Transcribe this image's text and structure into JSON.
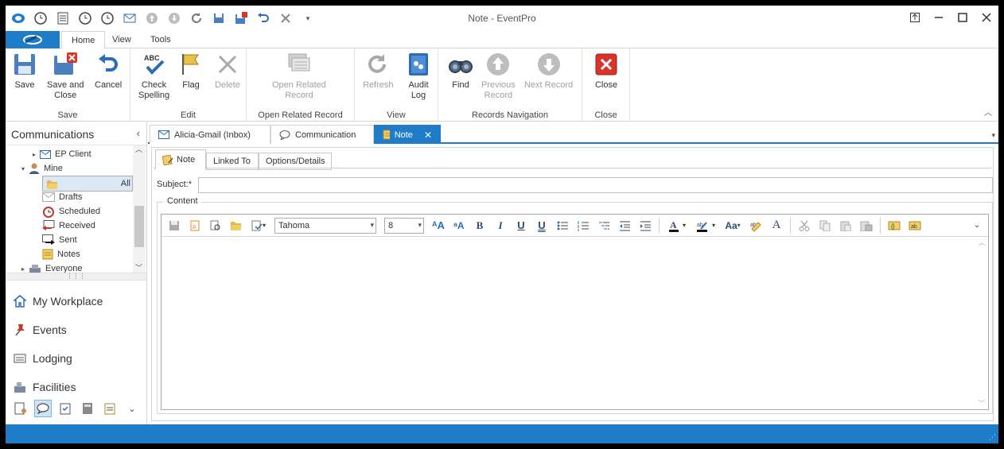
{
  "window": {
    "title": "Note - EventPro"
  },
  "quick_access_icons": [
    "eventpro-logo-icon",
    "clock-icon",
    "document-icon",
    "clock-icon",
    "clock-icon",
    "mail-icon",
    "up-arrow-icon",
    "down-arrow-icon",
    "refresh-icon",
    "save-icon",
    "save-close-icon",
    "undo-icon",
    "close-icon",
    "customize-icon"
  ],
  "ribbon": {
    "tabs": [
      "Home",
      "View",
      "Tools"
    ],
    "active_tab": "Home",
    "groups": {
      "save": {
        "caption": "Save",
        "save": "Save",
        "save_close_1": "Save and",
        "save_close_2": "Close",
        "cancel": "Cancel"
      },
      "edit": {
        "caption": "Edit",
        "check_1": "Check",
        "check_2": "Spelling",
        "check_abc": "ABC",
        "flag": "Flag",
        "delete": "Delete"
      },
      "open_related": {
        "caption": "Open Related Record",
        "btn_1": "Open Related",
        "btn_2": "Record"
      },
      "view": {
        "caption": "View",
        "refresh": "Refresh",
        "audit_1": "Audit",
        "audit_2": "Log"
      },
      "records_nav": {
        "caption": "Records Navigation",
        "find": "Find",
        "prev_1": "Previous",
        "prev_2": "Record",
        "next": "Next Record"
      },
      "close": {
        "caption": "Close",
        "close": "Close"
      }
    }
  },
  "nav": {
    "title": "Communications",
    "tree": [
      {
        "label": "EP Client",
        "icon": "mail-icon"
      },
      {
        "label": "Mine",
        "icon": "user-icon"
      },
      {
        "label": "All",
        "icon": "folder-open-icon",
        "selected": true
      },
      {
        "label": "Drafts",
        "icon": "mail-draft-icon"
      },
      {
        "label": "Scheduled",
        "icon": "alarm-clock-icon"
      },
      {
        "label": "Received",
        "icon": "mail-received-icon"
      },
      {
        "label": "Sent",
        "icon": "mail-sent-icon"
      },
      {
        "label": "Notes",
        "icon": "note-icon"
      },
      {
        "label": "Everyone",
        "icon": "group-icon"
      }
    ],
    "modules": [
      "My Workplace",
      "Events",
      "Lodging",
      "Facilities"
    ],
    "more_symbol": "⋮⋮⋮"
  },
  "doc_tabs": [
    {
      "label": "Alicia-Gmail (Inbox)",
      "icon": "mail-icon"
    },
    {
      "label": "Communication",
      "icon": "speech-bubble-icon"
    },
    {
      "label": "Note",
      "icon": "note-icon",
      "active": true
    }
  ],
  "form": {
    "tabs": [
      "Note",
      "Linked To",
      "Options/Details"
    ],
    "subject_label": "Subject:*",
    "subject_value": "",
    "content_legend": "Content",
    "font_name": "Tahoma",
    "font_size": "8"
  },
  "colors": {
    "accent": "#1f7cc9",
    "close_red": "#d9342b"
  }
}
